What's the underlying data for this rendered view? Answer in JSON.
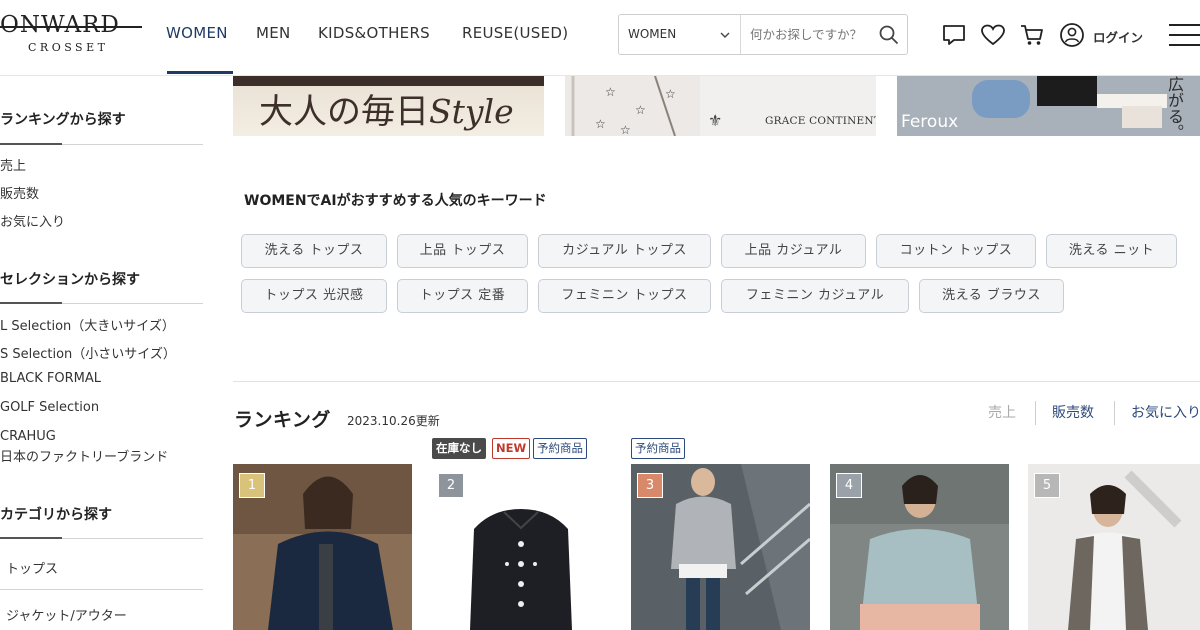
{
  "header": {
    "logo_main": "ONWARD",
    "logo_sub": "CROSSET",
    "nav": [
      "WOMEN",
      "MEN",
      "KIDS&OTHERS",
      "REUSE(USED)"
    ],
    "search_category": "WOMEN",
    "search_placeholder": "何かお探しですか？",
    "login_label": "ログイン",
    "icons": [
      "chat-icon",
      "heart-icon",
      "cart-icon",
      "user-icon",
      "hamburger-menu-icon"
    ]
  },
  "sidebar": {
    "ranking_heading": "ランキングから探す",
    "ranking_links": [
      "売上",
      "販売数",
      "お気に入り"
    ],
    "selection_heading": "セレクションから探す",
    "selection_links": [
      "L Selection（大きいサイズ）",
      "S Selection（小さいサイズ）",
      "BLACK FORMAL",
      "GOLF Selection",
      "CRAHUG",
      "日本のファクトリーブランド"
    ],
    "category_heading": "カテゴリから探す",
    "category_links": [
      "トップス",
      "ジャケット/アウター"
    ]
  },
  "banners": {
    "banner1_text": "大人の毎日",
    "banner1_script": "Style",
    "banner2_text": "GRACE CONTINENTAL",
    "banner3_text": "Feroux",
    "banner3_side": "広がる。"
  },
  "keywords": {
    "title": "WOMENでAIがおすすめする人気のキーワード",
    "row1": [
      "洗える トップス",
      "上品 トップス",
      "カジュアル トップス",
      "上品 カジュアル",
      "コットン トップス",
      "洗える ニット"
    ],
    "row2": [
      "トップス 光沢感",
      "トップス 定番",
      "フェミニン トップス",
      "フェミニン カジュアル",
      "洗える ブラウス"
    ]
  },
  "ranking": {
    "title": "ランキング",
    "updated": "2023.10.26更新",
    "tabs": [
      "売上",
      "販売数",
      "お気に入り"
    ],
    "active_tab": "売上",
    "badges_item2": [
      "在庫なし",
      "NEW",
      "予約商品"
    ],
    "badges_item3": [
      "予約商品"
    ],
    "items": [
      {
        "rank": "1",
        "rank_color": "#d9c37a"
      },
      {
        "rank": "2",
        "rank_color": "#8d949c"
      },
      {
        "rank": "3",
        "rank_color": "#d7896a"
      },
      {
        "rank": "4",
        "rank_color": "#9aa1a8"
      },
      {
        "rank": "5",
        "rank_color": "#b7b7b7"
      }
    ]
  },
  "colors": {
    "accent_navy": "#1f3a66",
    "badge_new_red": "#c0392b"
  }
}
